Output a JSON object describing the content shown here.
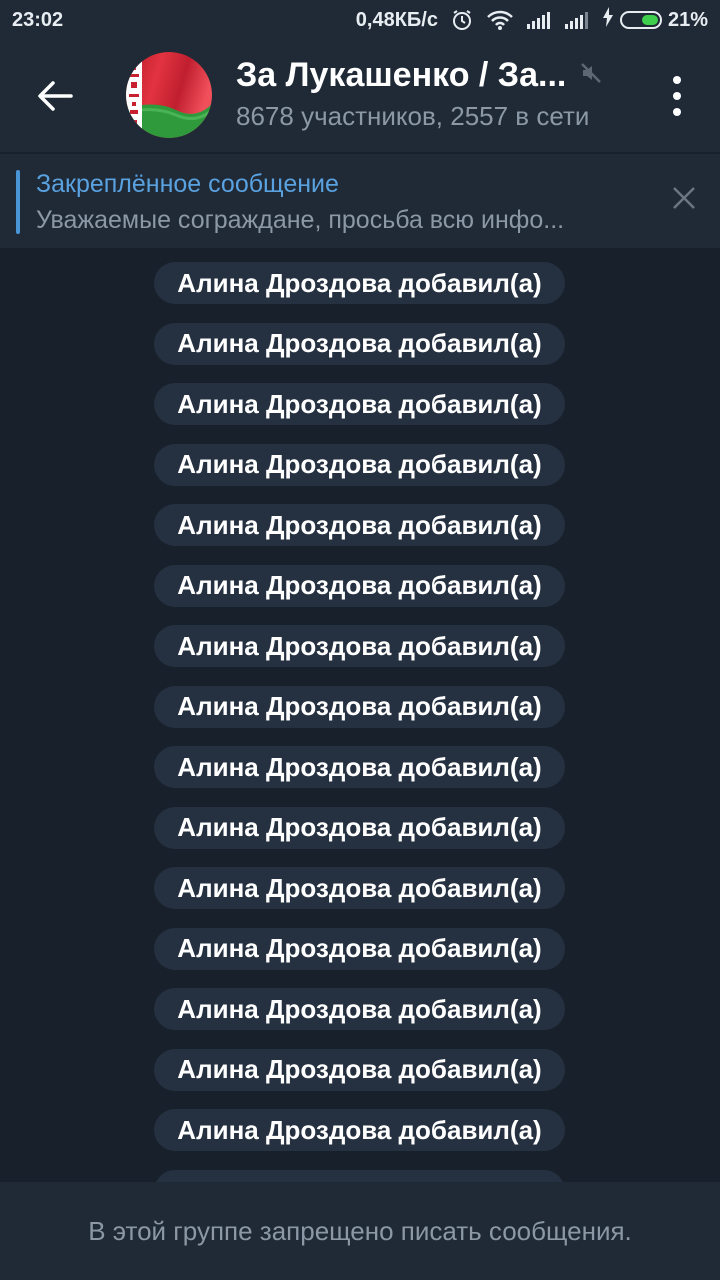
{
  "status_bar": {
    "time": "23:02",
    "net_speed": "0,48КБ/с",
    "battery": "21%",
    "battery_level": 0.21,
    "icons": [
      "alarm-icon",
      "wifi-icon",
      "signal-icon",
      "signal-icon",
      "charging-icon",
      "battery-icon"
    ]
  },
  "header": {
    "title": "За Лукашенко / За...",
    "subtitle": "8678 участников, 2557 в сети",
    "back_icon": "arrow-left-icon",
    "mute_icon": "muted-icon",
    "menu_icon": "more-vertical-icon",
    "avatar": "belarus-flag"
  },
  "pinned": {
    "title": "Закреплённое сообщение",
    "text": "Уважаемые сограждане, просьба всю инфо...",
    "close_icon": "close-icon"
  },
  "messages": [
    "Алина Дроздова добавил(а)",
    "Алина Дроздова добавил(а)",
    "Алина Дроздова добавил(а)",
    "Алина Дроздова добавил(а)",
    "Алина Дроздова добавил(а)",
    "Алина Дроздова добавил(а)",
    "Алина Дроздова добавил(а)",
    "Алина Дроздова добавил(а)",
    "Алина Дроздова добавил(а)",
    "Алина Дроздова добавил(а)",
    "Алина Дроздова добавил(а)",
    "Алина Дроздова добавил(а)",
    "Алина Дроздова добавил(а)",
    "Алина Дроздова добавил(а)",
    "Алина Дроздова добавил(а)"
  ],
  "footer": {
    "notice": "В этой группе запрещено писать сообщения."
  },
  "colors": {
    "accent": "#5aa1e0",
    "background": "#18202b",
    "bar": "#1f2a36",
    "service_bubble": "#253140",
    "battery_green": "#3ecf4d"
  }
}
